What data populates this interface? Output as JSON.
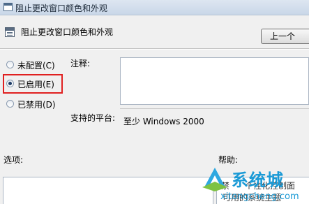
{
  "window": {
    "title": "阻止更改窗口颜色和外观"
  },
  "header": {
    "setting_title": "阻止更改窗口颜色和外观",
    "prev_button": "上一个"
  },
  "options": [
    {
      "label": "未配置(C)",
      "checked": false
    },
    {
      "label": "已启用(E)",
      "checked": true
    },
    {
      "label": "已禁用(D)",
      "checked": false
    }
  ],
  "fields": {
    "comment_label": "注释:",
    "comment_value": "",
    "supported_label": "支持的平台:",
    "supported_value": "至少 Windows 2000",
    "options_label": "选项:",
    "help_label": "帮助:"
  },
  "help_fragments": [
    "禁",
    "个性化控制面",
    "可用的系统主题"
  ],
  "watermark": {
    "text": "系统城",
    "url": "xitongcheng.com"
  },
  "colors": {
    "highlight": "#e02020",
    "watermark": "#1a9ad6"
  }
}
